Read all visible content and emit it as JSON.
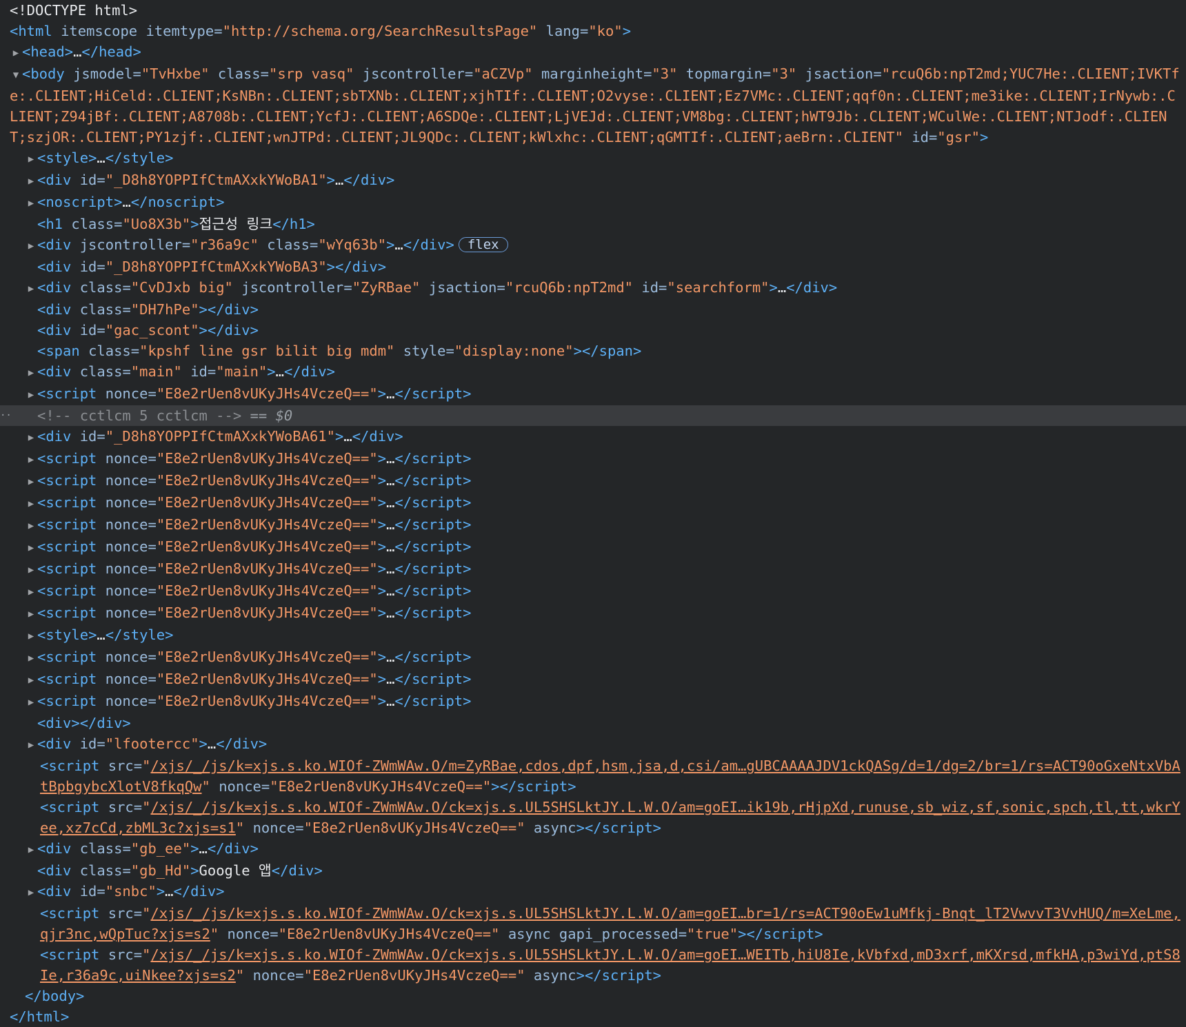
{
  "doctype": "<!DOCTYPE html>",
  "html_open": {
    "tag": "html",
    "attrs": [
      {
        "name": "itemscope",
        "value": null
      },
      {
        "name": "itemtype",
        "value": "http://schema.org/SearchResultsPage"
      },
      {
        "name": "lang",
        "value": "ko"
      }
    ]
  },
  "head": {
    "tag": "head"
  },
  "body_open": {
    "tag": "body",
    "attrs": [
      {
        "name": "jsmodel",
        "value": "TvHxbe"
      },
      {
        "name": "class",
        "value": "srp vasq"
      },
      {
        "name": "jscontroller",
        "value": "aCZVp"
      },
      {
        "name": "marginheight",
        "value": "3"
      },
      {
        "name": "topmargin",
        "value": "3"
      },
      {
        "name": "jsaction",
        "value": "rcuQ6b:npT2md;YUC7He:.CLIENT;IVKTfe:.CLIENT;HiCeld:.CLIENT;KsNBn:.CLIENT;sbTXNb:.CLIENT;xjhTIf:.CLIENT;O2vyse:.CLIENT;Ez7VMc:.CLIENT;qqf0n:.CLIENT;me3ike:.CLIENT;IrNywb:.CLIENT;Z94jBf:.CLIENT;A8708b:.CLIENT;YcfJ:.CLIENT;A6SDQe:.CLIENT;LjVEJd:.CLIENT;VM8bg:.CLIENT;hWT9Jb:.CLIENT;WCulWe:.CLIENT;NTJodf:.CLIENT;szjOR:.CLIENT;PY1zjf:.CLIENT;wnJTPd:.CLIENT;JL9QDc:.CLIENT;kWlxhc:.CLIENT;qGMTIf:.CLIENT;aeBrn:.CLIENT"
      },
      {
        "name": "id",
        "value": "gsr"
      }
    ]
  },
  "children": [
    {
      "tag": "style",
      "attrs": [],
      "collapsed": true
    },
    {
      "tag": "div",
      "attrs": [
        {
          "name": "id",
          "value": "_D8h8YOPPIfCtmAXxkYWoBA1"
        }
      ],
      "collapsed": true
    },
    {
      "tag": "noscript",
      "attrs": [],
      "collapsed": true
    },
    {
      "tag": "h1",
      "attrs": [
        {
          "name": "class",
          "value": "Uo8X3b"
        }
      ],
      "text": "접근성 링크"
    },
    {
      "tag": "div",
      "attrs": [
        {
          "name": "jscontroller",
          "value": "r36a9c"
        },
        {
          "name": "class",
          "value": "wYq63b"
        }
      ],
      "collapsed": true,
      "badge": "flex"
    },
    {
      "tag": "div",
      "attrs": [
        {
          "name": "id",
          "value": "_D8h8YOPPIfCtmAXxkYWoBA3"
        }
      ],
      "empty": true
    },
    {
      "tag": "div",
      "attrs": [
        {
          "name": "class",
          "value": "CvDJxb big"
        },
        {
          "name": "jscontroller",
          "value": "ZyRBae"
        },
        {
          "name": "jsaction",
          "value": "rcuQ6b:npT2md"
        },
        {
          "name": "id",
          "value": "searchform"
        }
      ],
      "collapsed": true
    },
    {
      "tag": "div",
      "attrs": [
        {
          "name": "class",
          "value": "DH7hPe"
        }
      ],
      "empty": true
    },
    {
      "tag": "div",
      "attrs": [
        {
          "name": "id",
          "value": "gac_scont"
        }
      ],
      "empty": true
    },
    {
      "tag": "span",
      "attrs": [
        {
          "name": "class",
          "value": "kpshf line gsr bilit big mdm"
        },
        {
          "name": "style",
          "value": "display:none"
        }
      ],
      "empty": true
    },
    {
      "tag": "div",
      "attrs": [
        {
          "name": "class",
          "value": "main"
        },
        {
          "name": "id",
          "value": "main"
        }
      ],
      "collapsed": true
    },
    {
      "tag": "script",
      "attrs": [
        {
          "name": "nonce",
          "value": "E8e2rUen8vUKyJHs4VczeQ=="
        }
      ],
      "collapsed": true
    },
    {
      "comment": "<!-- cctlcm 5 cctlcm -->",
      "selected": true,
      "suffix": "== $0"
    },
    {
      "tag": "div",
      "attrs": [
        {
          "name": "id",
          "value": "_D8h8YOPPIfCtmAXxkYWoBA61"
        }
      ],
      "collapsed": true
    },
    {
      "tag": "script",
      "attrs": [
        {
          "name": "nonce",
          "value": "E8e2rUen8vUKyJHs4VczeQ=="
        }
      ],
      "collapsed": true
    },
    {
      "tag": "script",
      "attrs": [
        {
          "name": "nonce",
          "value": "E8e2rUen8vUKyJHs4VczeQ=="
        }
      ],
      "collapsed": true
    },
    {
      "tag": "script",
      "attrs": [
        {
          "name": "nonce",
          "value": "E8e2rUen8vUKyJHs4VczeQ=="
        }
      ],
      "collapsed": true
    },
    {
      "tag": "script",
      "attrs": [
        {
          "name": "nonce",
          "value": "E8e2rUen8vUKyJHs4VczeQ=="
        }
      ],
      "collapsed": true
    },
    {
      "tag": "script",
      "attrs": [
        {
          "name": "nonce",
          "value": "E8e2rUen8vUKyJHs4VczeQ=="
        }
      ],
      "collapsed": true
    },
    {
      "tag": "script",
      "attrs": [
        {
          "name": "nonce",
          "value": "E8e2rUen8vUKyJHs4VczeQ=="
        }
      ],
      "collapsed": true
    },
    {
      "tag": "script",
      "attrs": [
        {
          "name": "nonce",
          "value": "E8e2rUen8vUKyJHs4VczeQ=="
        }
      ],
      "collapsed": true
    },
    {
      "tag": "script",
      "attrs": [
        {
          "name": "nonce",
          "value": "E8e2rUen8vUKyJHs4VczeQ=="
        }
      ],
      "collapsed": true
    },
    {
      "tag": "style",
      "attrs": [],
      "collapsed": true
    },
    {
      "tag": "script",
      "attrs": [
        {
          "name": "nonce",
          "value": "E8e2rUen8vUKyJHs4VczeQ=="
        }
      ],
      "collapsed": true
    },
    {
      "tag": "script",
      "attrs": [
        {
          "name": "nonce",
          "value": "E8e2rUen8vUKyJHs4VczeQ=="
        }
      ],
      "collapsed": true
    },
    {
      "tag": "script",
      "attrs": [
        {
          "name": "nonce",
          "value": "E8e2rUen8vUKyJHs4VczeQ=="
        }
      ],
      "collapsed": true
    },
    {
      "tag": "div",
      "attrs": [],
      "empty": true
    },
    {
      "tag": "div",
      "attrs": [
        {
          "name": "id",
          "value": "lfootercc"
        }
      ],
      "collapsed": true
    },
    {
      "tag": "script",
      "attrs": [
        {
          "name": "src",
          "value": "/xjs/_/js/k=xjs.s.ko.WIOf-ZWmWAw.O/m=ZyRBae,cdos,dpf,hsm,jsa,d,csi/am…gUBCAAAAJDV1ckQASg/d=1/dg=2/br=1/rs=ACT90oGxeNtxVbAtBpbgybcXlotV8fkqQw",
          "link": true
        },
        {
          "name": "nonce",
          "value": "E8e2rUen8vUKyJHs4VczeQ=="
        }
      ],
      "empty": true
    },
    {
      "tag": "script",
      "attrs": [
        {
          "name": "src",
          "value": "/xjs/_/js/k=xjs.s.ko.WIOf-ZWmWAw.O/ck=xjs.s.UL5SHSLktJY.L.W.O/am=goEI…ik19b,rHjpXd,runuse,sb_wiz,sf,sonic,spch,tl,tt,wkrYee,xz7cCd,zbML3c?xjs=s1",
          "link": true
        },
        {
          "name": "nonce",
          "value": "E8e2rUen8vUKyJHs4VczeQ=="
        },
        {
          "name": "async",
          "value": null
        }
      ],
      "empty": true
    },
    {
      "tag": "div",
      "attrs": [
        {
          "name": "class",
          "value": "gb_ee"
        }
      ],
      "collapsed": true
    },
    {
      "tag": "div",
      "attrs": [
        {
          "name": "class",
          "value": "gb_Hd"
        }
      ],
      "text": "Google 앱"
    },
    {
      "tag": "div",
      "attrs": [
        {
          "name": "id",
          "value": "snbc"
        }
      ],
      "collapsed": true
    },
    {
      "tag": "script",
      "attrs": [
        {
          "name": "src",
          "value": "/xjs/_/js/k=xjs.s.ko.WIOf-ZWmWAw.O/ck=xjs.s.UL5SHSLktJY.L.W.O/am=goEI…br=1/rs=ACT90oEw1uMfkj-Bnqt_lT2VwvvT3VvHUQ/m=XeLme,qjr3nc,wQpTuc?xjs=s2",
          "link": true
        },
        {
          "name": "nonce",
          "value": "E8e2rUen8vUKyJHs4VczeQ=="
        },
        {
          "name": "async",
          "value": null
        },
        {
          "name": "gapi_processed",
          "value": "true"
        }
      ],
      "empty": true
    },
    {
      "tag": "script",
      "attrs": [
        {
          "name": "src",
          "value": "/xjs/_/js/k=xjs.s.ko.WIOf-ZWmWAw.O/ck=xjs.s.UL5SHSLktJY.L.W.O/am=goEI…WEITb,hiU8Ie,kVbfxd,mD3xrf,mKXrsd,mfkHA,p3wiYd,ptS8Ie,r36a9c,uiNkee?xjs=s2",
          "link": true
        },
        {
          "name": "nonce",
          "value": "E8e2rUen8vUKyJHs4VczeQ=="
        },
        {
          "name": "async",
          "value": null
        }
      ],
      "empty": true
    }
  ],
  "body_close": "</body>",
  "html_close": "</html>",
  "ellipsis": "…",
  "colors": {
    "background": "#242628",
    "tag": "#5db0f6",
    "attribute": "#9bbbdc",
    "value": "#f29766",
    "text": "#e8eaed",
    "comment": "#8a8d91",
    "selected_row": "#3a3c3f"
  },
  "icons": {
    "collapsed": "triangle-right-icon",
    "expanded": "triangle-down-icon",
    "row_menu": "ellipsis-icon"
  }
}
